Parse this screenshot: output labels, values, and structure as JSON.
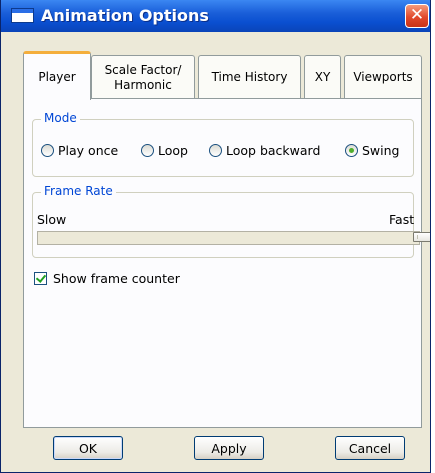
{
  "window": {
    "title": "Animation Options",
    "close_glyph": "✕"
  },
  "tabs": [
    {
      "label": "Player",
      "active": true
    },
    {
      "label": "Scale Factor/\nHarmonic",
      "active": false
    },
    {
      "label": "Time History",
      "active": false
    },
    {
      "label": "XY",
      "active": false
    },
    {
      "label": "Viewports",
      "active": false
    }
  ],
  "mode": {
    "title": "Mode",
    "options": [
      {
        "label": "Play once",
        "selected": false
      },
      {
        "label": "Loop",
        "selected": false
      },
      {
        "label": "Loop backward",
        "selected": false
      },
      {
        "label": "Swing",
        "selected": true
      }
    ]
  },
  "frame_rate": {
    "title": "Frame Rate",
    "min_label": "Slow",
    "max_label": "Fast",
    "value_fraction": 1.0
  },
  "show_frame_counter": {
    "label": "Show frame counter",
    "checked": true
  },
  "buttons": {
    "ok": "OK",
    "apply": "Apply",
    "cancel": "Cancel"
  },
  "colors": {
    "titlebar": "#0a4fd0",
    "group_title": "#0046d5",
    "active_tab_accent": "#f4ae3c",
    "dialog_bg": "#ece9d8"
  }
}
